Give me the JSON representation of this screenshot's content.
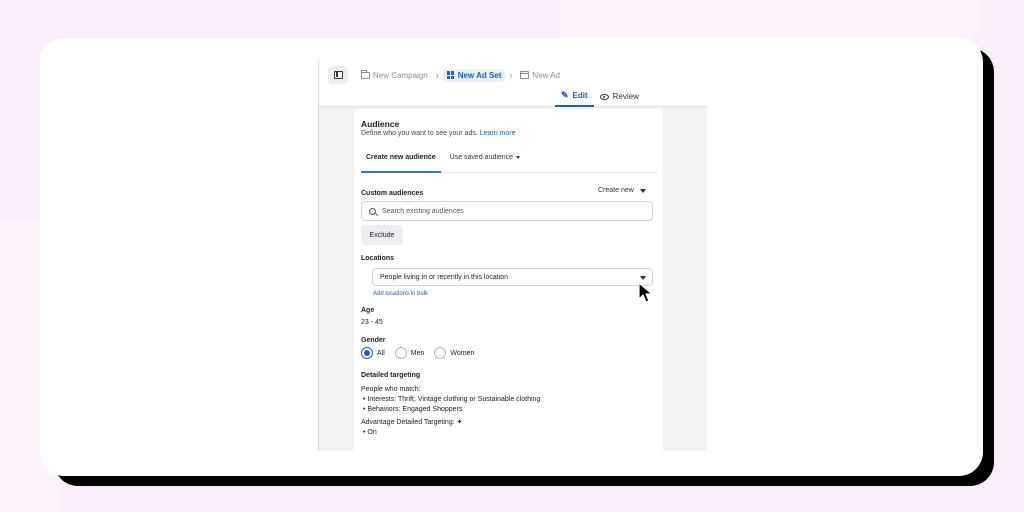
{
  "breadcrumb": {
    "campaign": "New Campaign",
    "ad_set": "New Ad Set",
    "ad": "New Ad"
  },
  "modes": {
    "edit": "Edit",
    "review": "Review"
  },
  "audience": {
    "title": "Audience",
    "description": "Define who you want to see your ads.",
    "learn_more": "Learn more"
  },
  "tabs": {
    "create_new": "Create new audience",
    "use_saved": "Use saved audience"
  },
  "custom_audiences": {
    "label": "Custom audiences",
    "create_new": "Create new",
    "search_placeholder": "Search existing audiences",
    "exclude": "Exclude"
  },
  "locations": {
    "label": "Locations",
    "selected": "People living in or recently in this location",
    "add_bulk": "Add locations in bulk"
  },
  "age": {
    "label": "Age",
    "value": "23 - 45"
  },
  "gender": {
    "label": "Gender",
    "options": [
      "All",
      "Men",
      "Women"
    ],
    "selected": "All"
  },
  "detailed_targeting": {
    "label": "Detailed targeting",
    "match_label": "People who match:",
    "items": [
      "Interests: Thrift, Vintage clothing or Sustainable clothing",
      "Behaviors: Engaged Shoppers"
    ],
    "advantage_label": "Advantage Detailed Targeting:",
    "advantage_value": "On"
  },
  "colors": {
    "accent": "#1c5fbf",
    "background": "#fbeefb",
    "card": "#ffffff"
  }
}
